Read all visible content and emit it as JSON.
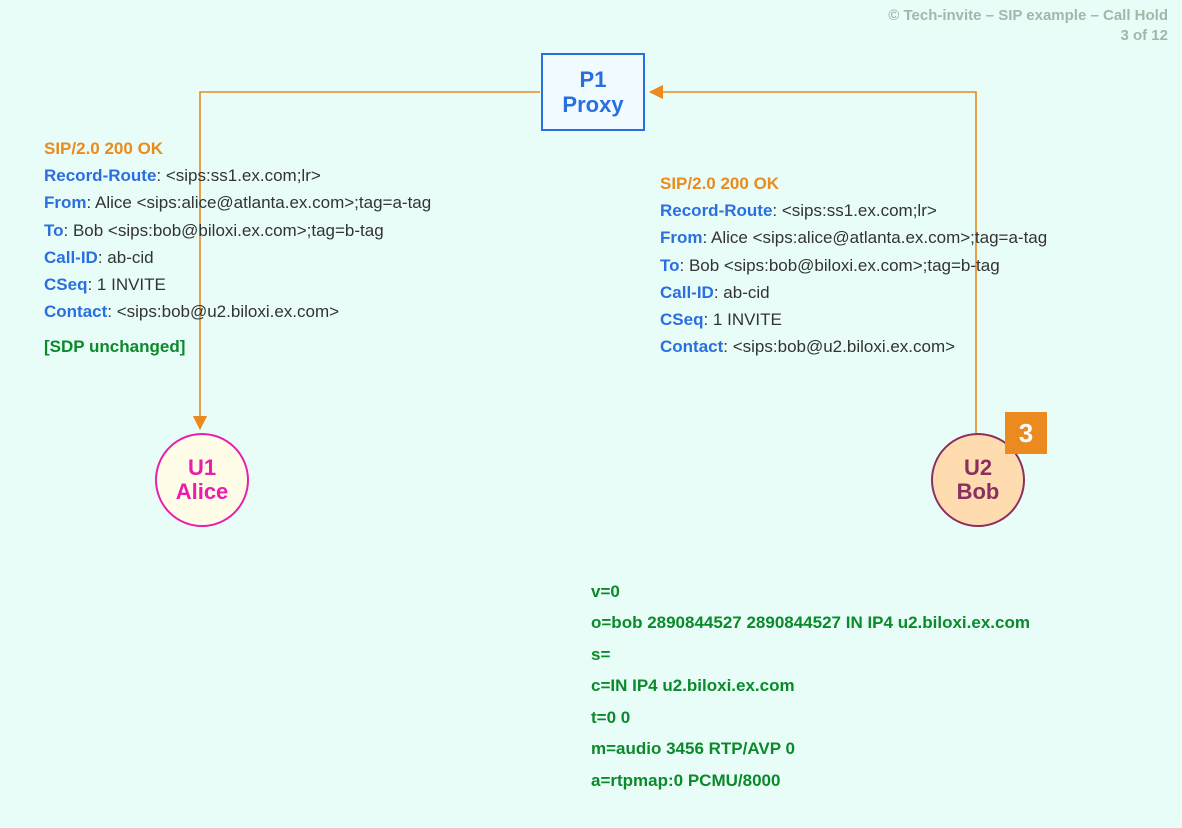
{
  "meta": {
    "copyright_line1": "© Tech-invite – SIP example – Call Hold",
    "copyright_line2": "3 of 12"
  },
  "nodes": {
    "proxy": {
      "line1": "P1",
      "line2": "Proxy"
    },
    "u1": {
      "line1": "U1",
      "line2": "Alice"
    },
    "u2": {
      "line1": "U2",
      "line2": "Bob"
    },
    "step_badge": "3"
  },
  "msg_left": {
    "status": "SIP/2.0 200 OK",
    "record_route_hdr": "Record-Route",
    "record_route_val": ": <sips:ss1.ex.com;lr>",
    "from_hdr": "From",
    "from_val": ": Alice <sips:alice@atlanta.ex.com>;tag=a-tag",
    "to_hdr": "To",
    "to_val": ": Bob <sips:bob@biloxi.ex.com>;tag=b-tag",
    "callid_hdr": "Call-ID",
    "callid_val": ": ab-cid",
    "cseq_hdr": "CSeq",
    "cseq_val": ": 1 INVITE",
    "contact_hdr": "Contact",
    "contact_val": ": <sips:bob@u2.biloxi.ex.com>",
    "sdp_note": "[SDP unchanged]"
  },
  "msg_right": {
    "status": "SIP/2.0 200 OK",
    "record_route_hdr": "Record-Route",
    "record_route_val": ": <sips:ss1.ex.com;lr>",
    "from_hdr": "From",
    "from_val": ": Alice <sips:alice@atlanta.ex.com>;tag=a-tag",
    "to_hdr": "To",
    "to_val": ": Bob <sips:bob@biloxi.ex.com>;tag=b-tag",
    "callid_hdr": "Call-ID",
    "callid_val": ": ab-cid",
    "cseq_hdr": "CSeq",
    "cseq_val": ": 1 INVITE",
    "contact_hdr": "Contact",
    "contact_val": ": <sips:bob@u2.biloxi.ex.com>"
  },
  "sdp": {
    "l1": "v=0",
    "l2": "o=bob  2890844527  2890844527  IN  IP4  u2.biloxi.ex.com",
    "l3": "s=",
    "l4": "c=IN  IP4  u2.biloxi.ex.com",
    "l5": "t=0  0",
    "l6": "m=audio  3456  RTP/AVP  0",
    "l7": "a=rtpmap:0  PCMU/8000"
  }
}
